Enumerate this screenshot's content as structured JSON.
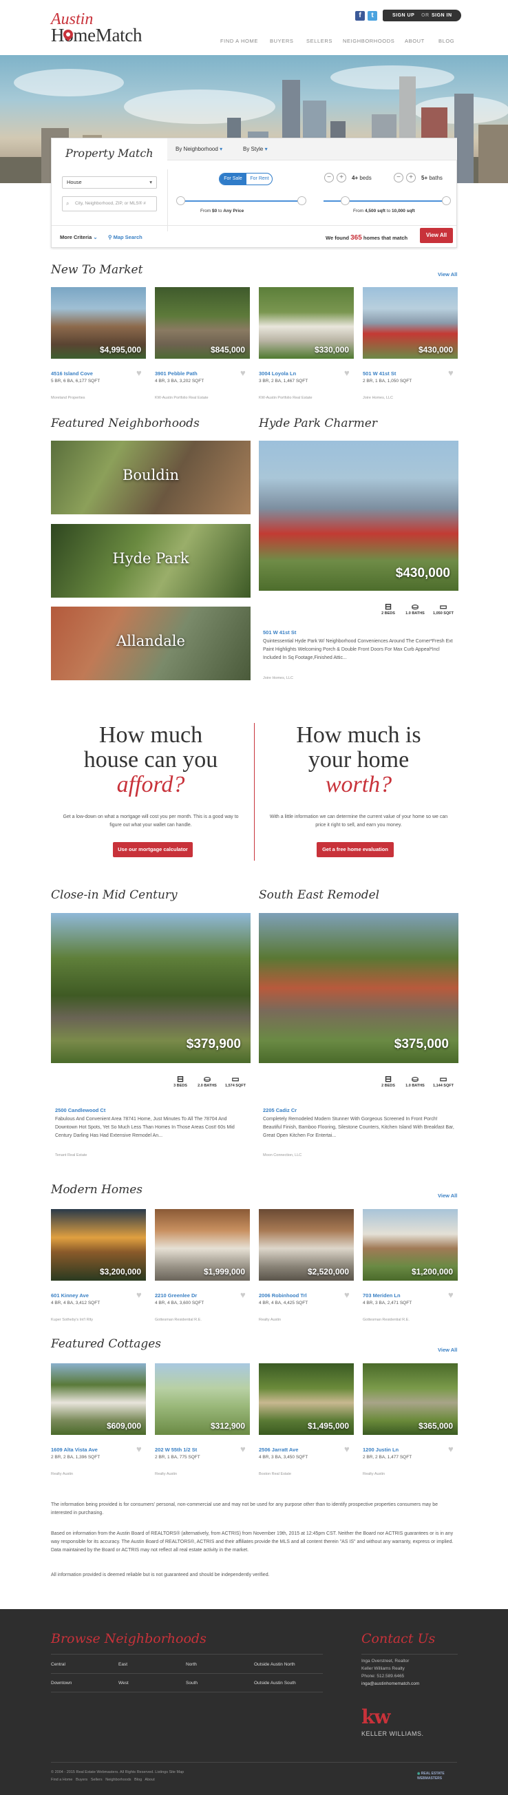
{
  "header": {
    "logo_line1": "Austin",
    "logo_line2": "HomeMatch",
    "social": [
      "f",
      "t"
    ],
    "sign_up": "SIGN UP",
    "or": "OR",
    "sign_in": "SIGN IN",
    "nav": [
      "FIND A HOME",
      "BUYERS",
      "SELLERS",
      "NEIGHBORHOODS",
      "ABOUT",
      "BLOG"
    ]
  },
  "search": {
    "title": "Property Match",
    "tab_neighborhood": "By Neighborhood",
    "tab_style": "By Style",
    "type_value": "House",
    "placeholder": "City, Neighborhood, ZIP, or MLS® #",
    "for_sale": "For Sale",
    "for_rent": "For Rent",
    "price_prefix": "From",
    "price_low": "$0",
    "price_mid": "to",
    "price_high": "Any Price",
    "beds_value": "4+",
    "beds_label": "beds",
    "baths_value": "5+",
    "baths_label": "baths",
    "sqft_prefix": "From",
    "sqft_low": "4,500 sqft",
    "sqft_mid": "to",
    "sqft_high": "10,000 sqft",
    "more_criteria": "More Criteria",
    "map_search": "Map Search",
    "found_prefix": "We found",
    "found_count": "365",
    "found_suffix": "homes that match",
    "view_all": "View All"
  },
  "new_to_market": {
    "title": "New To Market",
    "view_all": "View All",
    "listings": [
      {
        "price": "$4,995,000",
        "address": "4516 Island Cove",
        "specs": "5 BR, 6 BA, 6,177 SQFT",
        "broker": "Moreland Properties"
      },
      {
        "price": "$845,000",
        "address": "3901 Pebble Path",
        "specs": "4 BR, 3 BA, 3,202 SQFT",
        "broker": "KW-Austin Portfolio Real Estate"
      },
      {
        "price": "$330,000",
        "address": "3004 Loyola Ln",
        "specs": "3 BR, 2 BA, 1,467 SQFT",
        "broker": "KW-Austin Portfolio Real Estate"
      },
      {
        "price": "$430,000",
        "address": "501 W 41st St",
        "specs": "2 BR, 1 BA, 1,050 SQFT",
        "broker": "Joire Homes, LLC"
      }
    ]
  },
  "featured_neighborhoods": {
    "title": "Featured Neighborhoods",
    "items": [
      "Bouldin",
      "Hyde Park",
      "Allandale"
    ]
  },
  "hyde_park": {
    "title": "Hyde Park Charmer",
    "price": "$430,000",
    "beds": "2 BEDS",
    "baths": "1.0 BATHS",
    "sqft": "1,050 SQFT",
    "address": "501 W 41st St",
    "description": "Quintessential Hyde Park W/ Neighborhood Conveniences Around The Corner*Fresh Ext Paint Highlights Welcoming Porch & Double Front Doors For Max Curb Appeal*Incl Included In Sq Footage,Finished Attic...",
    "broker": "Joire Homes, LLC"
  },
  "afford": {
    "line1": "How much",
    "line2": "house can you",
    "line3": "afford?",
    "text": "Get a low-down on what a mortgage will cost you per month. This is a good way to figure out what your wallet can handle.",
    "button": "Use our mortgage calculator"
  },
  "worth": {
    "line1": "How much is",
    "line2": "your home",
    "line3": "worth?",
    "text": "With a little information we can determine the current value of your home so we can price it right to sell, and earn you money.",
    "button": "Get a free home evaluation"
  },
  "mid_century": {
    "title": "Close-in Mid Century",
    "price": "$379,900",
    "beds": "3 BEDS",
    "baths": "2.0 BATHS",
    "sqft": "1,574 SQFT",
    "address": "2500 Candlewood Ct",
    "description": "Fabulous And Convenient Area 78741 Home, Just Minutes To All The 78704 And Downtown Hot Spots, Yet So Much Less Than Homes In Those Areas Cost! 60s Mid Century Darling Has Had Extensive Remodel An...",
    "broker": "Tenant Real Estate"
  },
  "se_remodel": {
    "title": "South East Remodel",
    "price": "$375,000",
    "beds": "2 BEDS",
    "baths": "1.0 BATHS",
    "sqft": "1,144 SQFT",
    "address": "2205 Cadiz Cr",
    "description": "Completely Remodeled Modern Stunner With Gorgeous Screened In Front Porch! Beautiful Finish, Bamboo Flooring, Silestone Counters, Kitchen Island With Breakfast Bar, Great Open Kitchen For Entertai...",
    "broker": "Moon Connection, LLC"
  },
  "modern_homes": {
    "title": "Modern Homes",
    "view_all": "View All",
    "listings": [
      {
        "price": "$3,200,000",
        "address": "601 Kinney Ave",
        "specs": "4 BR, 4 BA, 3,412 SQFT",
        "broker": "Kuper Sotheby's Int'l Rlty"
      },
      {
        "price": "$1,999,000",
        "address": "2210 Greenlee Dr",
        "specs": "4 BR, 4 BA, 3,600 SQFT",
        "broker": "Gottesman Residential R.E."
      },
      {
        "price": "$2,520,000",
        "address": "2006 Robinhood Trl",
        "specs": "4 BR, 4 BA, 4,425 SQFT",
        "broker": "Realty Austin"
      },
      {
        "price": "$1,200,000",
        "address": "703 Meriden Ln",
        "specs": "4 BR, 3 BA, 2,471 SQFT",
        "broker": "Gottesman Residential R.E."
      }
    ]
  },
  "featured_cottages": {
    "title": "Featured Cottages",
    "view_all": "View All",
    "listings": [
      {
        "price": "$609,000",
        "address": "1609 Alta Vista Ave",
        "specs": "2 BR, 2 BA, 1,396 SQFT",
        "broker": "Realty Austin"
      },
      {
        "price": "$312,900",
        "address": "202 W 55th 1/2 St",
        "specs": "2 BR, 1 BA, 775 SQFT",
        "broker": "Realty Austin"
      },
      {
        "price": "$1,495,000",
        "address": "2506 Jarratt Ave",
        "specs": "4 BR, 3 BA, 3,450 SQFT",
        "broker": "Boston Real Estate"
      },
      {
        "price": "$365,000",
        "address": "1200 Justin Ln",
        "specs": "2 BR, 2 BA, 1,477 SQFT",
        "broker": "Realty Austin"
      }
    ]
  },
  "disclaimer": {
    "p1": "The information being provided is for consumers' personal, non-commercial use and may not be used for any purpose other than to identify prospective properties consumers may be interested in purchasing.",
    "p2": "Based on information from the Austin Board of REALTORS® (alternatively, from ACTRIS) from November 19th, 2015 at 12:45pm CST. Neither the Board nor ACTRIS guarantees or is in any way responsible for its accuracy. The Austin Board of REALTORS®, ACTRIS and their affiliates provide the MLS and all content therein \"AS IS\" and without any warranty, express or implied. Data maintained by the Board or ACTRIS may not reflect all real estate activity in the market.",
    "p3": "All information provided is deemed reliable but is not guaranteed and should be independently verified."
  },
  "footer": {
    "browse_title": "Browse Neighborhoods",
    "hoods": [
      "Central",
      "East",
      "North",
      "Outside Austin North",
      "Downtown",
      "West",
      "South",
      "Outside Austin South"
    ],
    "contact_title": "Contact Us",
    "contact": [
      "Inga Overstreet, Realtor",
      "Keller Williams Realty",
      "Phone: 512.589.6465",
      "inga@austinhomematch.com"
    ],
    "kw_mark": "kw",
    "kw_name": "KELLER WILLIAMS.",
    "copyright": "© 2004 - 2015 Real Estate Webmasters. All Rights Reserved. Listings Site Map",
    "links": [
      "Find a Home",
      "Buyers",
      "Sellers",
      "Neighborhoods",
      "Blog",
      "About"
    ],
    "rew": "REAL ESTATE WEBMASTERS"
  }
}
